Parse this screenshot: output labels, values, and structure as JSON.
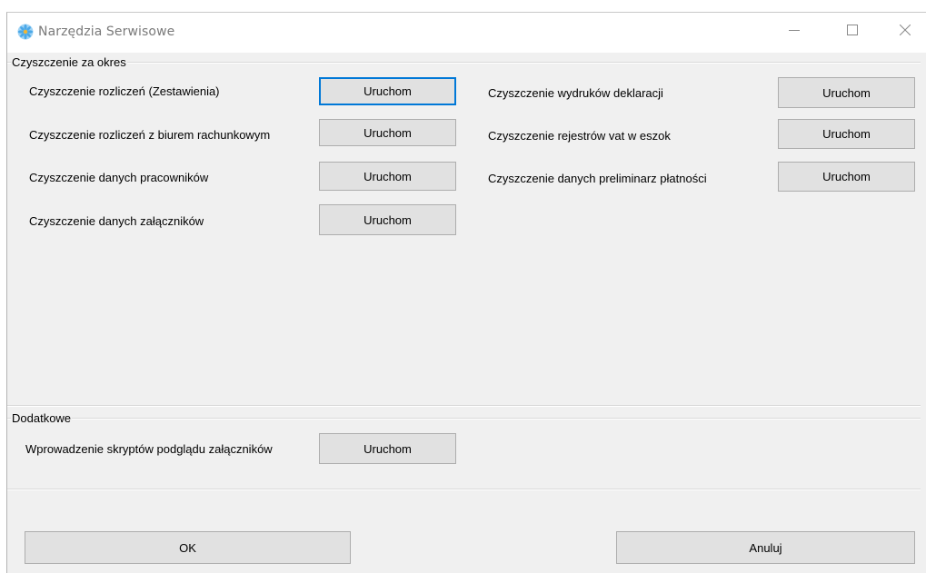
{
  "window": {
    "title": "Narzędzia Serwisowe",
    "icon": "flower-app-icon"
  },
  "titlebar_controls": {
    "minimize": "—",
    "maximize": "☐",
    "close": "✕"
  },
  "groups": {
    "period_cleanup": {
      "label": "Czyszczenie za okres",
      "left_items": [
        {
          "label": "Czyszczenie rozliczeń (Zestawienia)",
          "button": "Uruchom"
        },
        {
          "label": "Czyszczenie rozliczeń z biurem rachunkowym",
          "button": "Uruchom"
        },
        {
          "label": "Czyszczenie danych pracowników",
          "button": "Uruchom"
        },
        {
          "label": "Czyszczenie danych załączników",
          "button": "Uruchom"
        }
      ],
      "right_items": [
        {
          "label": "Czyszczenie wydruków deklaracji",
          "button": "Uruchom"
        },
        {
          "label": "Czyszczenie rejestrów vat w eszok",
          "button": "Uruchom"
        },
        {
          "label": "Czyszczenie danych preliminarz płatności",
          "button": "Uruchom"
        }
      ]
    },
    "additional": {
      "label": "Dodatkowe",
      "items": [
        {
          "label": "Wprowadzenie skryptów podglądu załączników",
          "button": "Uruchom"
        }
      ]
    }
  },
  "footer": {
    "ok": "OK",
    "cancel": "Anuluj"
  },
  "colors": {
    "window_bg": "#f0f0f0",
    "button_bg": "#e1e1e1",
    "focus_border": "#0078d7"
  }
}
